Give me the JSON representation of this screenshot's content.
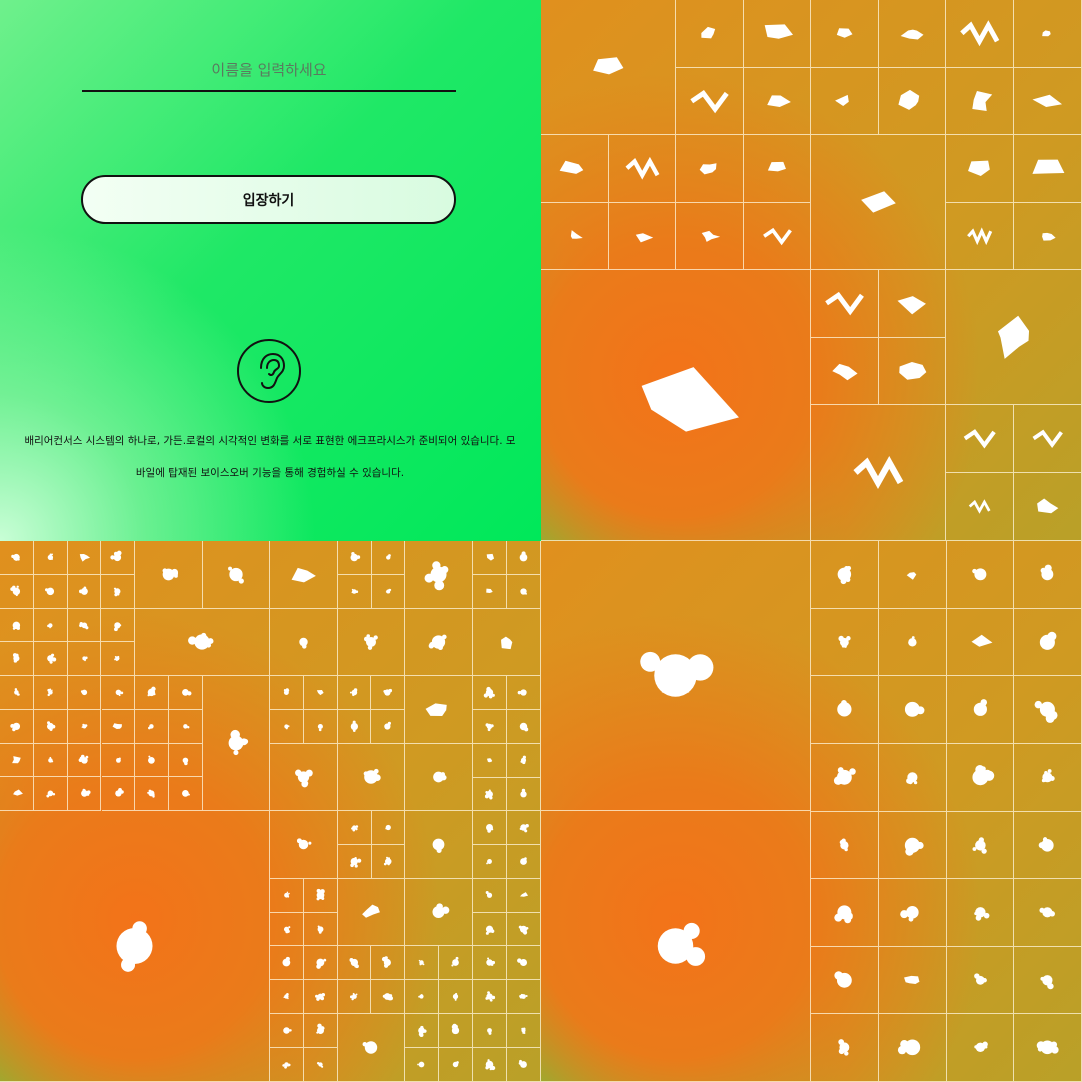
{
  "login": {
    "name_placeholder": "이름을 입력하세요",
    "enter_label": "입장하기",
    "description": "배리어컨서스 시스템의 하나로, 가든.로컬의 시각적인 변화를 서로 표현한 에크프라시스가 준비되어 있습니다. 모바일에 탑재된 보이스오버 기능을 통해 경험하실 수 있습니다.",
    "icon": "ear-icon"
  },
  "colors": {
    "green_bright": "#00e85a",
    "green_light": "#d2ffdc",
    "orange": "#f37319",
    "mustard": "#c9a024",
    "shape_fill": "#ffffff",
    "grid_line": "#fff5dc"
  },
  "mosaic_panels": [
    {
      "name": "mosaic-polygons",
      "shape_style": "angular"
    },
    {
      "name": "mosaic-blobs-mixed",
      "shape_style": "blob"
    },
    {
      "name": "mosaic-blobs-large",
      "shape_style": "blob"
    }
  ]
}
